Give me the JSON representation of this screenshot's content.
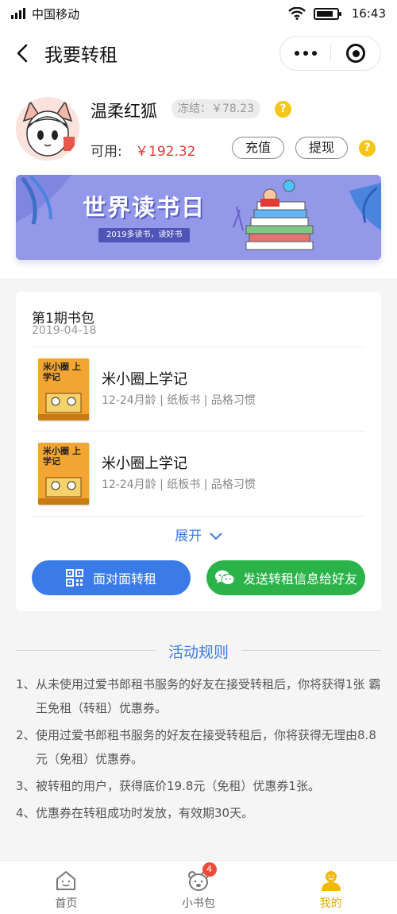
{
  "status_bar": {
    "carrier": "中国移动",
    "time": "16:43"
  },
  "nav": {
    "title": "我要转租"
  },
  "profile": {
    "username": "温柔红狐",
    "frozen": "冻结：￥78.23",
    "available_label": "可用:",
    "available_value": "￥192.32",
    "recharge_label": "充值",
    "withdraw_label": "提现",
    "help_mark": "?"
  },
  "banner": {
    "title": "世界读书日",
    "subtitle": "2019多读书，读好书"
  },
  "package": {
    "title": "第1期书包",
    "date": "2019-04-18",
    "books": [
      {
        "name": "米小圈上学记",
        "meta": "12-24月龄 | 纸板书 | 品格习惯",
        "cover_text": "米小圈 上学记"
      },
      {
        "name": "米小圈上学记",
        "meta": "12-24月龄 | 纸板书 | 品格习惯",
        "cover_text": "米小圈 上学记"
      }
    ],
    "expand_label": "展开",
    "face_to_face_label": "面对面转租",
    "share_label": "发送转租信息给好友"
  },
  "rules": {
    "title": "活动规则",
    "items": [
      {
        "num": "1、",
        "text": "从未使用过爱书郎租书服务的好友在接受转租后，你将获得1张 霸王免租（转租）优惠券。"
      },
      {
        "num": "2、",
        "text": "使用过爱书郎租书服务的好友在接受转租后，你将获得无理由8.8元（免租）优惠券。"
      },
      {
        "num": "3、",
        "text": "被转租的用户，获得底价19.8元（免租）优惠券1张。"
      },
      {
        "num": "4、",
        "text": "优惠券在转租成功时发放，有效期30天。"
      }
    ]
  },
  "tabbar": {
    "tabs": [
      {
        "label": "首页",
        "icon": "home-icon"
      },
      {
        "label": "小书包",
        "icon": "bear-bag-icon",
        "badge": "4"
      },
      {
        "label": "我的",
        "icon": "smiley-user-icon",
        "active": true
      }
    ]
  },
  "colors": {
    "accent_blue": "#3b7be8",
    "wechat_green": "#2bb34a",
    "price_red": "#e53935",
    "active_tab": "#e7a300",
    "help_yellow": "#f5c518"
  }
}
